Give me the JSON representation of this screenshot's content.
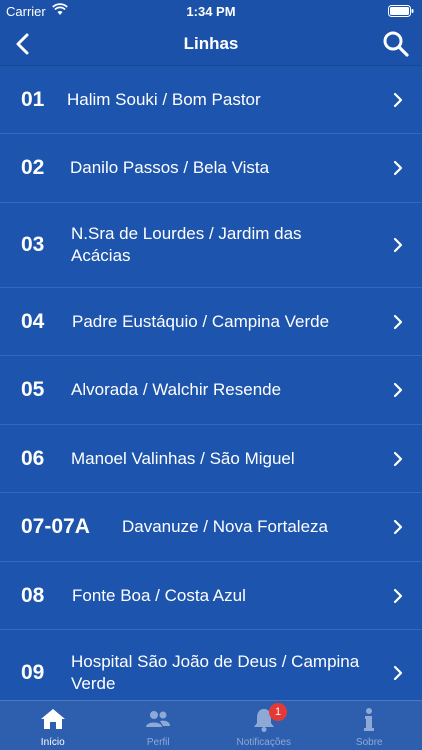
{
  "status": {
    "carrier": "Carrier",
    "time": "1:34 PM"
  },
  "nav": {
    "title": "Linhas"
  },
  "lines": [
    {
      "number": "01",
      "name": "Halim Souki / Bom Pastor"
    },
    {
      "number": "02",
      "name": "Danilo Passos / Bela Vista"
    },
    {
      "number": "03",
      "name": "N.Sra de Lourdes / Jardim das Acácias"
    },
    {
      "number": "04",
      "name": "Padre Eustáquio / Campina Verde"
    },
    {
      "number": "05",
      "name": "Alvorada / Walchir Resende"
    },
    {
      "number": "06",
      "name": "Manoel Valinhas / São Miguel"
    },
    {
      "number": "07-07A",
      "name": "Davanuze / Nova Fortaleza"
    },
    {
      "number": "08",
      "name": "Fonte Boa / Costa Azul"
    },
    {
      "number": "09",
      "name": "Hospital São João de Deus / Campina Verde"
    }
  ],
  "tabs": [
    {
      "label": "Início",
      "icon": "home-icon",
      "active": true
    },
    {
      "label": "Perfil",
      "icon": "users-icon",
      "active": false
    },
    {
      "label": "Notificações",
      "icon": "bell-icon",
      "active": false,
      "badge": "1"
    },
    {
      "label": "Sobre",
      "icon": "info-icon",
      "active": false
    }
  ],
  "colors": {
    "background": "#1d54ad",
    "tab_bar": "#2e5fae",
    "badge": "#e53935"
  }
}
